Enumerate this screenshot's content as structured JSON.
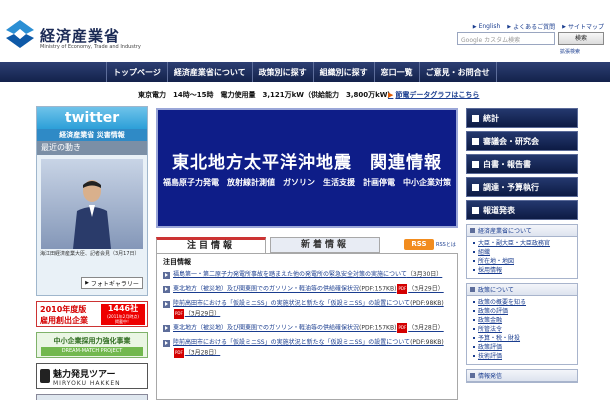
{
  "header": {
    "logo_ja": "経済産業省",
    "logo_en": "Ministry of Economy, Trade and Industry",
    "util_links": [
      "English",
      "よくあるご質問",
      "サイトマップ"
    ],
    "search_placeholder": "Google カスタム検索",
    "search_button": "検索",
    "advanced_search": "拡張検索"
  },
  "nav": [
    "トップページ",
    "経済産業省について",
    "政策別に探す",
    "組織別に探す",
    "窓口一覧",
    "ご意見・お問合せ"
  ],
  "power": {
    "text": "東京電力　14時～15時　電力使用量　3,121万kW（供給能力　3,800万kW）",
    "link": "節電データグラフはこちら"
  },
  "twitter": {
    "logo": "twitter",
    "title": "経済産業省 災害情報",
    "recent": "最近の動き",
    "caption": "海江田経済産業大臣、記者会見（3月17日）",
    "gallery": "フォトギャラリー"
  },
  "banners": {
    "b2010_line1": "2010年度版",
    "b2010_line2": "雇用創出企業",
    "b2010_badge_num": "1446社",
    "b2010_badge_note": "(2011年2月時点)",
    "b2010_badge_tail": "掲載中！",
    "dream_line1": "中小企業採用力強化事業",
    "dream_line2": "DREAM-MATCH PROJECT",
    "miryoku_line1": "魅力発見ツアー",
    "miryoku_line2": "MIRYOKU HAKKEN"
  },
  "hero": {
    "title": "東北地方太平洋沖地震　関連情報",
    "subtitle": "福島原子力発電　放射線計測値　ガソリン　生活支援　計画停電　中小企業対策"
  },
  "tabs": {
    "attention": "注目情報",
    "new": "新着情報",
    "rss": "RSS",
    "rss_label": "RSSとは"
  },
  "news": {
    "heading": "注目情報",
    "items": [
      {
        "text": "福島第一・第二原子力発電所事故を踏まえた他の発電所の緊急安全対策の実施について",
        "pdf": "",
        "date": "（3月30日）"
      },
      {
        "text": "東北地方（被災地）及び関東圏でのガソリン・軽油等の供給確保状況",
        "pdf": "(PDF:157KB)",
        "date": "（3月29日）"
      },
      {
        "text": "陸前高田市における「仮設ミニSS」の実施状況と新たな「仮設ミニSS」の設置について",
        "pdf": "(PDF:98KB)",
        "date": "（3月29日）"
      },
      {
        "text": "東北地方（被災地）及び関東圏でのガソリン・軽油等の供給確保状況",
        "pdf": "(PDF:157KB)",
        "date": "（3月28日）"
      },
      {
        "text": "陸前高田市における「仮設ミニSS」の実施状況と新たな「仮設ミニSS」の設置について",
        "pdf": "(PDF:98KB)",
        "date": "（3月28日）"
      }
    ]
  },
  "right": {
    "buttons": [
      "統計",
      "審議会・研究会",
      "白書・報告書",
      "調達・予算執行",
      "報道発表"
    ],
    "panel1_head": "経済産業省について",
    "panel1_items": [
      "大臣・副大臣・大臣政務官",
      "組織",
      "所在地・地図",
      "採用情報"
    ],
    "panel2_head": "政策について",
    "panel2_items": [
      "政策の概要を知る",
      "政策の評価",
      "政策金融",
      "所管法令",
      "予算・税・財投",
      "政策評価",
      "技術評価"
    ],
    "panel3_head": "情報発信"
  }
}
